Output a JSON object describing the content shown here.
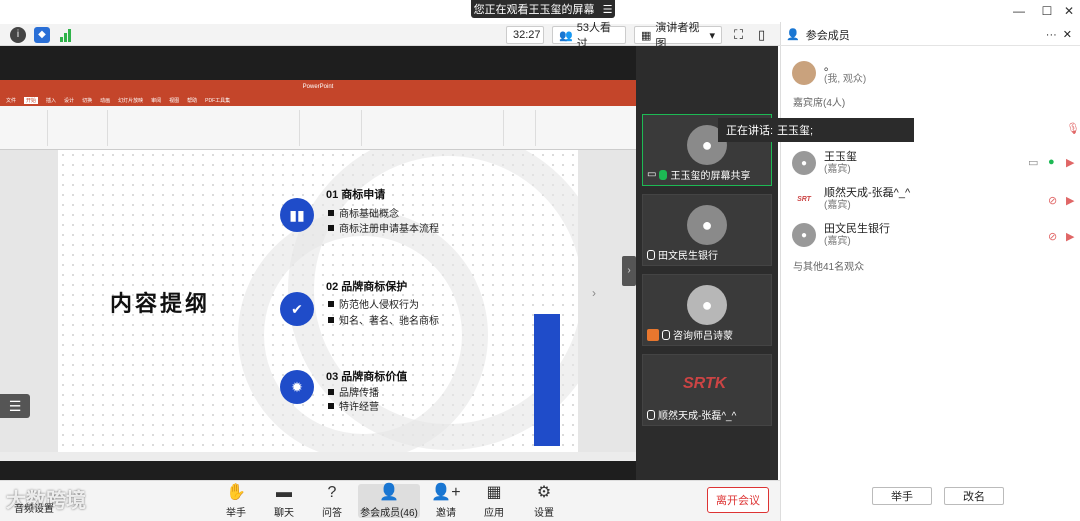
{
  "banner": {
    "text": "您正在观看王玉玺的屏幕",
    "icon": "list-icon"
  },
  "toolbar": {
    "timer": "32:27",
    "viewers": "53人看过",
    "view_mode": "演讲者视图",
    "icons": [
      "info-icon",
      "shield-icon",
      "signal-icon",
      "fullscreen-icon",
      "layout-icon"
    ]
  },
  "panel": {
    "title": "参会成员",
    "self": {
      "name": "。",
      "role": "(我, 观众)"
    },
    "guests_label": "嘉宾席(4人)",
    "members": [
      {
        "name": "王玉玺",
        "role": "(嘉宾)"
      },
      {
        "name": "顺然天成-张磊^_^",
        "role": "(嘉宾)"
      },
      {
        "name": "田文民生银行",
        "role": "(嘉宾)"
      }
    ],
    "others": "与其他41名观众",
    "raise_hand": "举手",
    "rename": "改名"
  },
  "speaking": {
    "prefix": "正在讲话:",
    "name": "王玉玺;"
  },
  "tiles": [
    {
      "label": "王玉玺的屏幕共享",
      "active": true
    },
    {
      "label": "田文民生银行",
      "active": false
    },
    {
      "label": "咨询师吕诗蒙",
      "active": false
    },
    {
      "label": "顺然天成-张磊^_^",
      "active": false
    }
  ],
  "srt_logo": "SRTK",
  "slide": {
    "heading": "内容提纲",
    "sections": [
      {
        "title": "01  商标申请",
        "items": [
          "商标基础概念",
          "商标注册申请基本流程"
        ],
        "icon": "document-icon"
      },
      {
        "title": "02  品牌商标保护",
        "items": [
          "防范他人侵权行为",
          "知名、著名、驰名商标"
        ],
        "icon": "bird-icon"
      },
      {
        "title": "03  品牌商标价值",
        "items": [
          "品牌传播",
          "特许经营"
        ],
        "icon": "lightbulb-icon"
      }
    ]
  },
  "ppt": {
    "app": "PowerPoint",
    "tabs": [
      "文件",
      "开始",
      "插入",
      "设计",
      "切换",
      "动画",
      "幻灯片放映",
      "审阅",
      "视图",
      "帮助",
      "PDF工具集"
    ]
  },
  "bottombar": {
    "buttons": [
      {
        "label": "举手",
        "icon": "hand-icon"
      },
      {
        "label": "聊天",
        "icon": "chat-icon"
      },
      {
        "label": "问答",
        "icon": "question-icon"
      },
      {
        "label": "参会成员(46)",
        "icon": "person-icon"
      },
      {
        "label": "邀请",
        "icon": "invite-icon"
      },
      {
        "label": "应用",
        "icon": "apps-icon"
      },
      {
        "label": "设置",
        "icon": "gear-icon"
      }
    ],
    "leave": "离开会议",
    "settings_left": "音频设置"
  },
  "watermark": "大数跨境",
  "colors": {
    "accent_blue": "#1f4cc9",
    "ppt_red": "#c4452a",
    "leave_red": "#dd3333",
    "active_green": "#1db954"
  }
}
